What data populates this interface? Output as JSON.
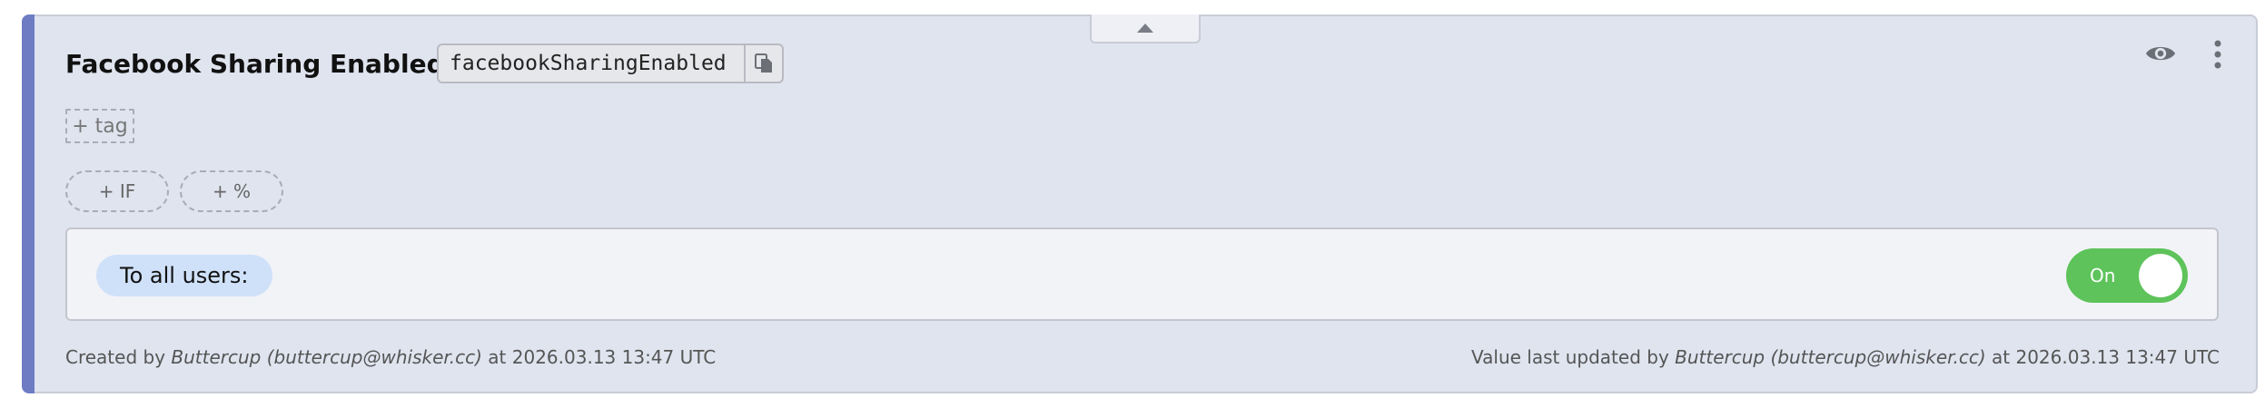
{
  "feature": {
    "title": "Facebook Sharing Enabled",
    "key": "facebookSharingEnabled"
  },
  "actions": {
    "add_tag_label": "+ tag",
    "add_if_label": "+ IF",
    "add_percent_label": "+ %"
  },
  "rule": {
    "audience_label": "To all users:",
    "toggle_label": "On",
    "toggle_state": true
  },
  "footer": {
    "created_prefix": "Created by",
    "created_by": "Buttercup (buttercup@whisker.cc)",
    "created_at": "at 2026.03.13 13:47 UTC",
    "updated_prefix": "Value last updated by",
    "updated_by": "Buttercup (buttercup@whisker.cc)",
    "updated_at": "at 2026.03.13 13:47 UTC"
  },
  "icons": {
    "collapse": "chevron-up-icon",
    "copy": "copy-icon",
    "visibility": "eye-icon",
    "menu": "more-vertical-icon"
  },
  "colors": {
    "card_background": "#dfe4ef",
    "accent": "#6e7cc4",
    "toggle_on": "#5dc35a",
    "audience_chip": "#cfe1f9"
  }
}
